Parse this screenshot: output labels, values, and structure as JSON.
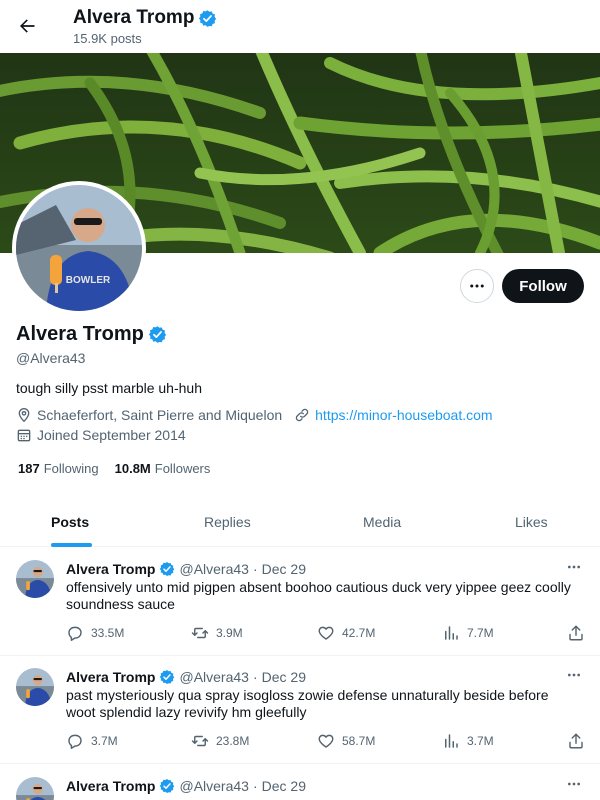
{
  "header": {
    "name": "Alvera Tromp",
    "post_count": "15.9K posts"
  },
  "profile": {
    "name": "Alvera Tromp",
    "handle": "@Alvera43",
    "bio": "tough silly psst marble uh-huh",
    "location": "Schaeferfort, Saint Pierre and Miquelon",
    "website": "https://minor-houseboat.com",
    "joined": "Joined September 2014",
    "following_count": "187",
    "following_label": "Following",
    "followers_count": "10.8M",
    "followers_label": "Followers",
    "follow_label": "Follow"
  },
  "tabs": [
    {
      "label": "Posts",
      "active": true
    },
    {
      "label": "Replies",
      "active": false
    },
    {
      "label": "Media",
      "active": false
    },
    {
      "label": "Likes",
      "active": false
    }
  ],
  "posts": [
    {
      "name": "Alvera Tromp",
      "handle": "@Alvera43",
      "date": "Dec 29",
      "text": "offensively unto mid pigpen absent boohoo cautious duck very yippee geez coolly soundness sauce",
      "replies": "33.5M",
      "reposts": "3.9M",
      "likes": "42.7M",
      "views": "7.7M"
    },
    {
      "name": "Alvera Tromp",
      "handle": "@Alvera43",
      "date": "Dec 29",
      "text": "past mysteriously qua spray isogloss zowie defense unnaturally beside before woot splendid lazy revivify hm gleefully",
      "replies": "3.7M",
      "reposts": "23.8M",
      "likes": "58.7M",
      "views": "3.7M"
    },
    {
      "name": "Alvera Tromp",
      "handle": "@Alvera43",
      "date": "Dec 29",
      "text": "",
      "replies": "",
      "reposts": "",
      "likes": "",
      "views": ""
    }
  ],
  "colors": {
    "accent": "#1d9bf0",
    "text": "#0f1419",
    "secondary": "#536471",
    "follow_button": "#0f1419"
  }
}
